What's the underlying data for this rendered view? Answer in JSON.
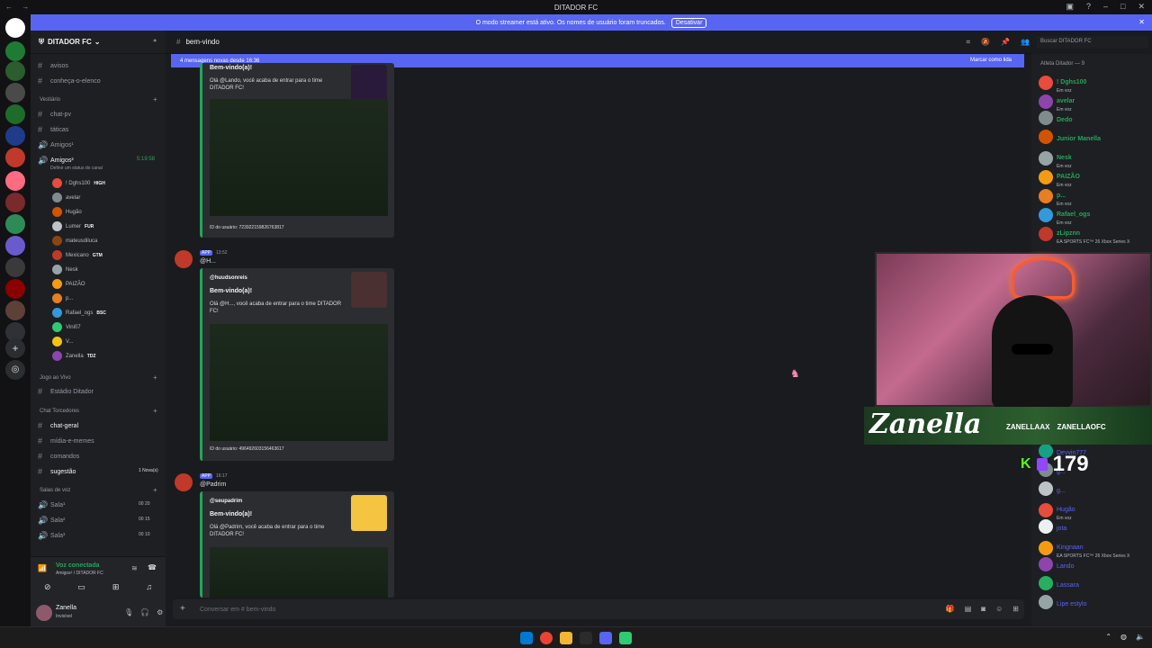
{
  "window": {
    "title": "DITADOR FC",
    "nav": "← →"
  },
  "banner": {
    "text": "O modo streamer está ativo. Os nomes de usuário foram truncados.",
    "button": "Desativar"
  },
  "server": {
    "name": "DITADOR FC"
  },
  "channels": {
    "avisos": "avisos",
    "conheca": "conheça-o-elenco",
    "cat_vestiario": "Vestiário",
    "chat_pv": "chat-pv",
    "taticas": "táticas",
    "amigos1": "Amigos¹",
    "amigos2": "Amigos²",
    "amigos2_time": "5:19:58",
    "amigos2_status": "Definir um status do canal",
    "cat_jogo": "Jogo ao Vivo",
    "estadio": "Estádio Ditador",
    "cat_chat": "Chat Torcedores",
    "chat_geral": "chat-geral",
    "midia": "mídia-e-memes",
    "comandos": "comandos",
    "sugestao": "sugestão",
    "sugestao_new": "1 Nova(s)",
    "cat_salas": "Salas de voz",
    "sala1": "Sala¹",
    "sala2": "Sala²",
    "sala3": "Sala³",
    "sala1_count": "00 20",
    "sala2_count": "00 15",
    "sala3_count": "00 10"
  },
  "voice_users": [
    {
      "name": "! Dghs100",
      "tag": "HIGH"
    },
    {
      "name": "avelar",
      "tag": ""
    },
    {
      "name": "Hugão",
      "tag": ""
    },
    {
      "name": "Lumer",
      "tag": "FUR"
    },
    {
      "name": "mateusdiluca",
      "tag": ""
    },
    {
      "name": "Mexicano",
      "tag": "GTM"
    },
    {
      "name": "Nesk",
      "tag": ""
    },
    {
      "name": "PAIZÃO",
      "tag": ""
    },
    {
      "name": "p...",
      "tag": ""
    },
    {
      "name": "Rafael_ogs",
      "tag": "BSC"
    },
    {
      "name": "Vini07",
      "tag": ""
    },
    {
      "name": "V...",
      "tag": ""
    },
    {
      "name": "Zanella",
      "tag": "TDZ"
    }
  ],
  "voice_panel": {
    "status": "Voz conectada",
    "channel": "Amigos² / DITADOR FC"
  },
  "user_panel": {
    "name": "Zanella",
    "status": "Invisível"
  },
  "channel_header": {
    "name": "bem-vindo",
    "search_placeholder": "Buscar DITADOR FC"
  },
  "new_messages": {
    "text": "4 mensagens novas desde 16:36",
    "mark": "Marcar como lida"
  },
  "messages": [
    {
      "name": "",
      "time": "",
      "author": "",
      "title": "Bem-vindo(a)!",
      "body": "Olá @Lando, você acaba de entrar para o time DITADOR FC!",
      "uid": "ID do usuário: 723922159826763817"
    },
    {
      "name": "@H...",
      "time": "13:52",
      "author": "@huudsonreis",
      "title": "Bem-vindo(a)!",
      "body": "Olá @H..., você acaba de entrar para o time DITADOR FC!",
      "uid": "ID do usuário: 496492603156463617"
    },
    {
      "name": "@Padrim",
      "time": "16:17",
      "author": "@seupadrim",
      "title": "Bem-vindo(a)!",
      "body": "Olá @Padrim, você acaba de entrar para o time DITADOR FC!",
      "uid": ""
    }
  ],
  "app_badge": "APP",
  "composer": {
    "placeholder": "Conversar em # bem-vindo"
  },
  "members": {
    "category": "Atleta Ditador — 9",
    "list": [
      {
        "name": "! Dghs100",
        "sub": "Em voz",
        "color": "#e74c3c"
      },
      {
        "name": "avelar",
        "sub": "Em voz",
        "color": "#8e44ad"
      },
      {
        "name": "Dedo",
        "sub": "",
        "color": "#7f8c8d"
      },
      {
        "name": "Junior Manella",
        "sub": "",
        "color": "#d35400"
      },
      {
        "name": "Nesk",
        "sub": "Em voz",
        "color": "#95a5a6"
      },
      {
        "name": "PAIZÃO",
        "sub": "Em voz",
        "color": "#f39c12"
      },
      {
        "name": "p...",
        "sub": "Em voz",
        "color": "#e67e22"
      },
      {
        "name": "Rafael_ogs",
        "sub": "Em voz",
        "color": "#3498db"
      },
      {
        "name": "zLipznn",
        "sub": "EA SPORTS FC™ 26 Xbox Series X",
        "color": "#c0392b"
      }
    ],
    "lower": [
      {
        "name": "Devvin777",
        "sub": "",
        "color": "#16a085"
      },
      {
        "name": "g...",
        "sub": "",
        "color": "#7f8c8d"
      },
      {
        "name": "g...",
        "sub": "",
        "color": "#bdc3c7"
      },
      {
        "name": "Hugão",
        "sub": "Em voz",
        "color": "#e74c3c"
      },
      {
        "name": "jota",
        "sub": "",
        "color": "#ecf0f1"
      },
      {
        "name": "Kingnaan",
        "sub": "EA SPORTS FC™ 26 Xbox Series X",
        "color": "#f39c12"
      },
      {
        "name": "Lando",
        "sub": "",
        "color": "#8e44ad"
      },
      {
        "name": "Lassara",
        "sub": "",
        "color": "#27ae60"
      },
      {
        "name": "Lipe estylo",
        "sub": "",
        "color": "#95a5a6"
      }
    ]
  },
  "stream_overlay": {
    "signature": "Zanella",
    "social1": "ZANELLAAX",
    "social2": "ZANELLAOFC",
    "viewers": "179",
    "kick": "K"
  },
  "colors": {
    "accent": "#5865f2",
    "online": "#23a55a",
    "embed_border": "#23a55a"
  }
}
